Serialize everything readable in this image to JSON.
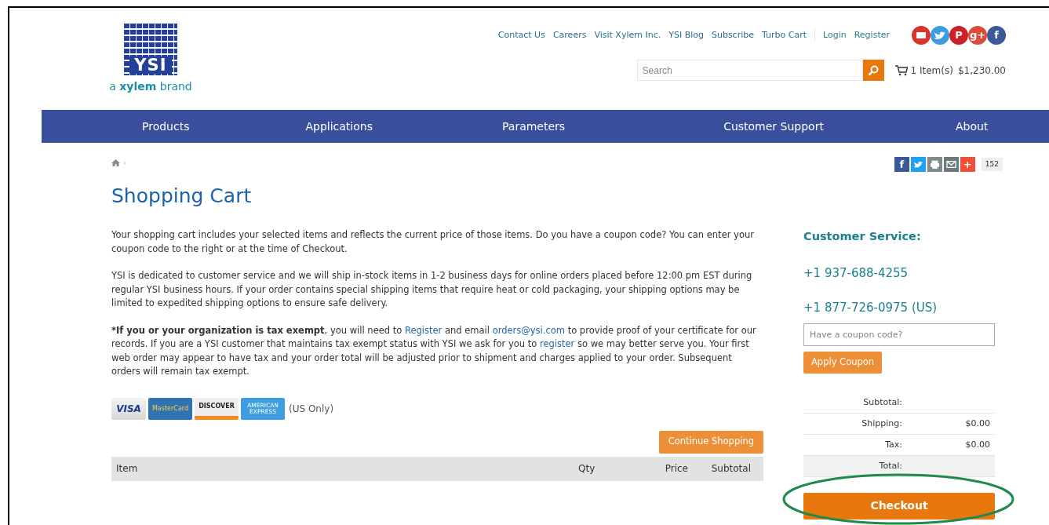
{
  "logo": {
    "mark": "YSI",
    "tagline": "a **xylem** brand"
  },
  "top_links": [
    {
      "label": "Contact Us"
    },
    {
      "label": "Careers"
    },
    {
      "label": "Visit Xylem Inc."
    },
    {
      "label": "YSI Blog"
    },
    {
      "label": "Subscribe"
    },
    {
      "label": "Turbo Cart"
    }
  ],
  "account_links": [
    {
      "label": "Login"
    },
    {
      "label": "Register"
    }
  ],
  "social_icons": [
    {
      "kind": "youtube",
      "color": "#d9342b"
    },
    {
      "kind": "twitter",
      "color": "#3d9be0"
    },
    {
      "kind": "glyph",
      "text": "P",
      "color": "#cb2027"
    },
    {
      "kind": "glyph",
      "text": "g+",
      "color": "#dd4b39"
    },
    {
      "kind": "glyph",
      "text": "f",
      "color": "#3b5998"
    }
  ],
  "search": {
    "placeholder": "Search"
  },
  "cart_summary": {
    "items": "1 Item(s)",
    "amount": "$1,230.00"
  },
  "nav": [
    {
      "label": "Products"
    },
    {
      "label": "Applications"
    },
    {
      "label": "Parameters"
    },
    {
      "label": "Customer Support"
    },
    {
      "label": "About"
    }
  ],
  "breadcrumb": {
    "separator": "›"
  },
  "share": {
    "buttons": [
      {
        "kind": "glyph",
        "text": "f",
        "color": "#3b5998"
      },
      {
        "kind": "twitter",
        "color": "#1da1f2"
      },
      {
        "kind": "print",
        "color": "#7f8c8d"
      },
      {
        "kind": "email",
        "color": "#6c7a7b"
      },
      {
        "kind": "glyph",
        "text": "+",
        "color": "#f04e37"
      }
    ],
    "count": "152"
  },
  "title": "Shopping Cart",
  "paragraphs": [
    [
      {
        "kind": "text",
        "text": "Your shopping cart includes your selected items and reflects the current price of those items.  Do you have a coupon code?  You can enter your coupon code to the right or at the time of Checkout."
      }
    ],
    [
      {
        "kind": "text",
        "text": "YSI is dedicated to customer service and we will ship in-stock items in 1-2 business days for online orders placed before 12:00 pm EST during regular YSI business hours.  If your order contains special shipping items that require heat or cold packaging, your shipping options may be limited to expedited shipping options to ensure safe delivery."
      }
    ],
    [
      {
        "kind": "bold",
        "text": "*If you or your organization is tax exempt"
      },
      {
        "kind": "text",
        "text": ", you will need to "
      },
      {
        "kind": "link",
        "text": "Register"
      },
      {
        "kind": "text",
        "text": " and email "
      },
      {
        "kind": "link",
        "text": "orders@ysi.com"
      },
      {
        "kind": "text",
        "text": " to provide proof of your certificate for our records.  If you are a YSI customer that maintains tax exempt status with YSI we ask for you to "
      },
      {
        "kind": "link",
        "text": "register"
      },
      {
        "kind": "text",
        "text": " so we may better serve you.  Your first web order may appear to have tax and your order total will be adjusted prior to shipment and charges applied to your order.  Subsequent orders will remain tax exempt."
      }
    ]
  ],
  "payment_cards": [
    {
      "kind": "visa",
      "text": "VISA"
    },
    {
      "kind": "mastercard",
      "text": "MasterCard"
    },
    {
      "kind": "discover",
      "text": "DISCOVER"
    },
    {
      "kind": "amex",
      "text": "AMERICAN EXPRESS"
    }
  ],
  "payment_note": "(US Only)",
  "continue_button": "Continue Shopping",
  "table": {
    "columns": [
      "Item",
      "Qty",
      "Price",
      "Subtotal"
    ]
  },
  "sidebar": {
    "heading": "Customer Service:",
    "phones": [
      "+1 937-688-4255",
      "+1 877-726-0975 (US)"
    ],
    "coupon": {
      "placeholder": "Have a coupon code?"
    },
    "apply_button": "Apply Coupon",
    "totals": [
      {
        "label": "Subtotal:"
      },
      {
        "label": "Shipping:",
        "value": "$0.00"
      },
      {
        "label": "Tax:",
        "value": "$0.00"
      },
      {
        "label": "Total:",
        "shaded": true
      }
    ],
    "checkout_button": "Checkout"
  }
}
